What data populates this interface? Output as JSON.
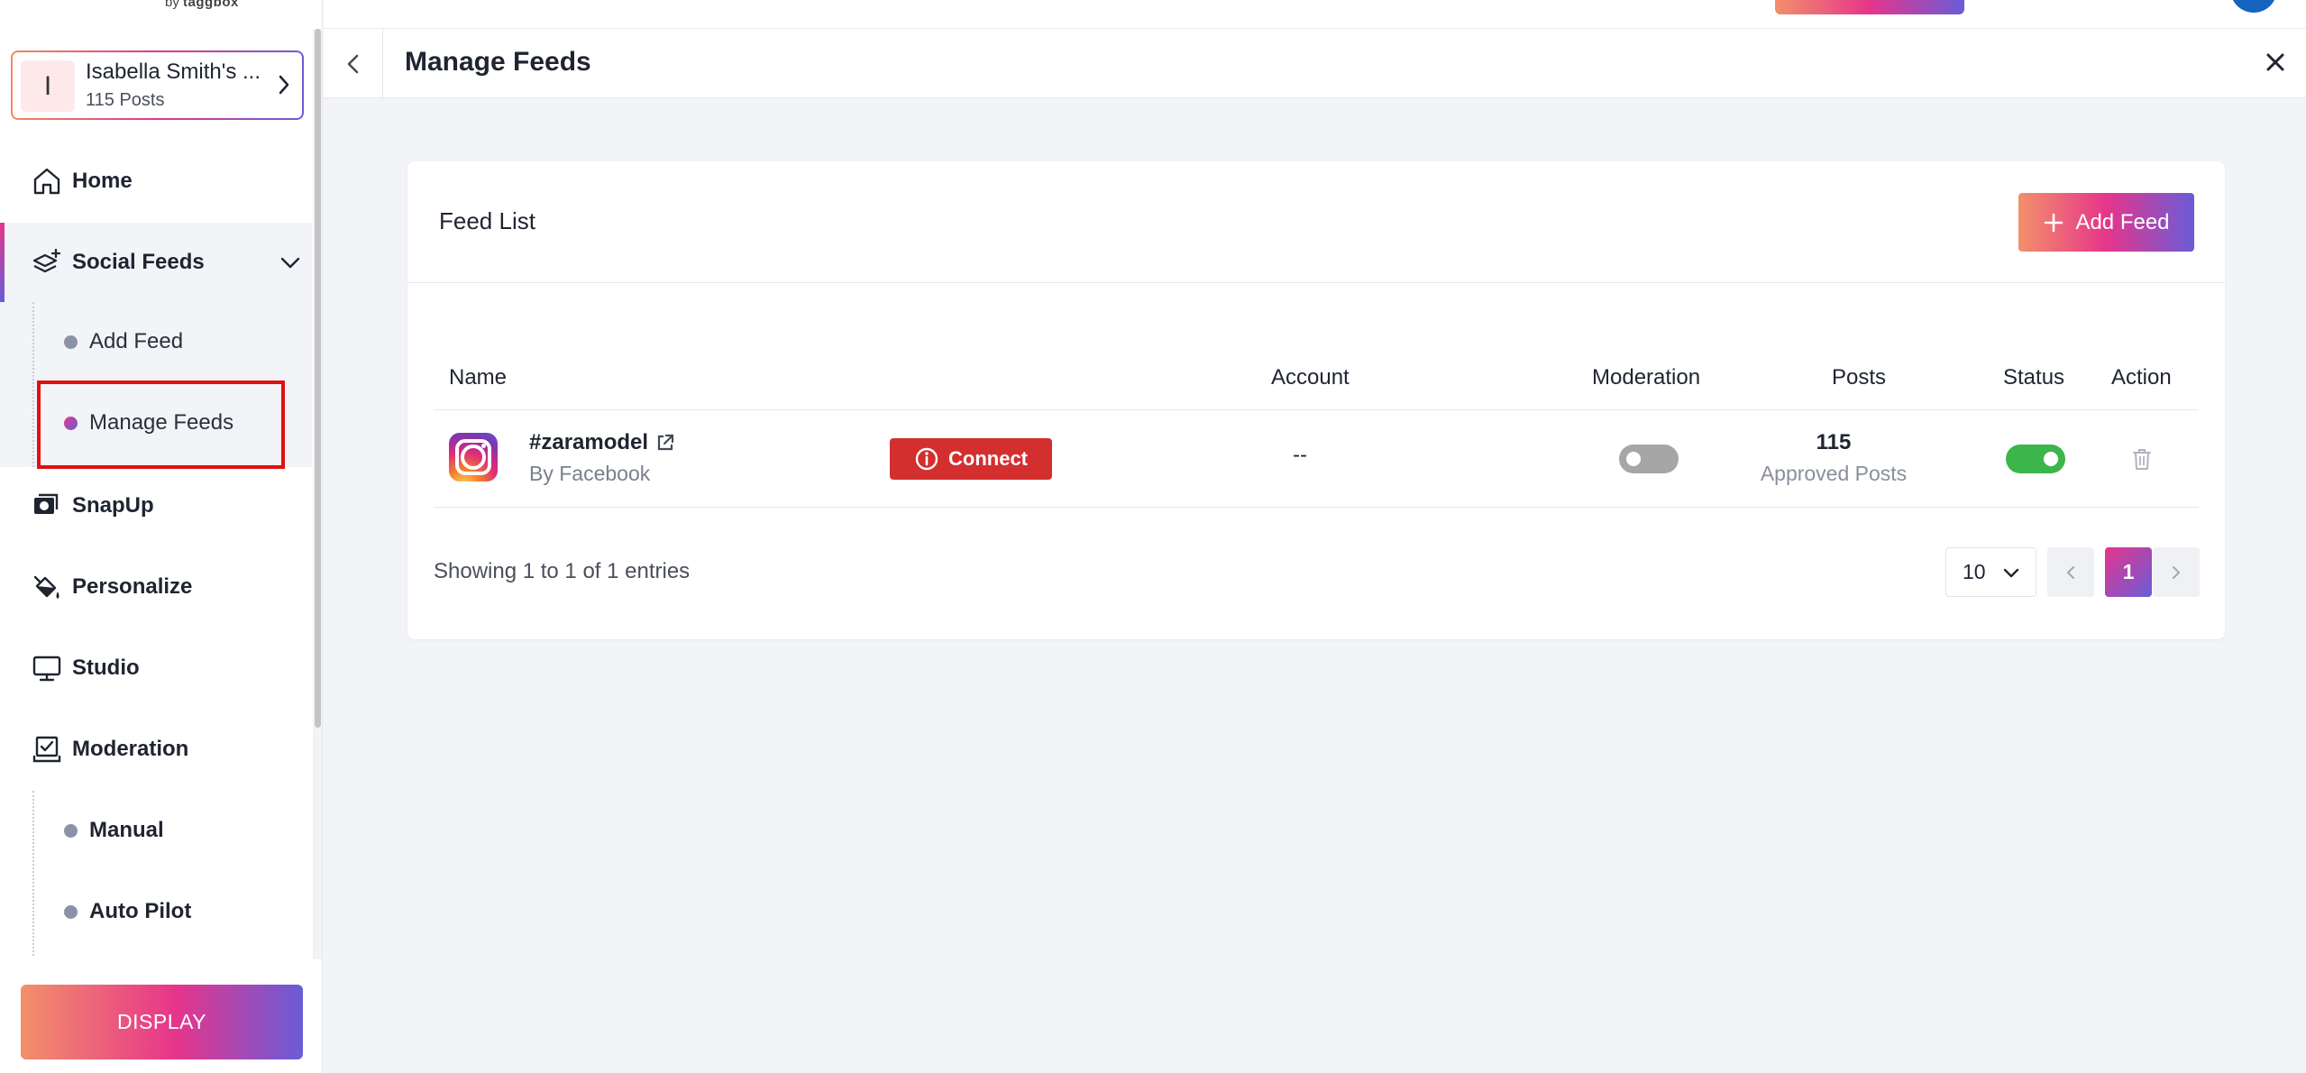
{
  "brand": {
    "prefix": "by",
    "name": "taggbox"
  },
  "account": {
    "initial": "I",
    "name": "Isabella Smith's ...",
    "posts": "115 Posts"
  },
  "nav": {
    "home": "Home",
    "social_feeds": "Social Feeds",
    "social_sub": {
      "add_feed": "Add Feed",
      "manage_feeds": "Manage Feeds"
    },
    "snapup": "SnapUp",
    "personalize": "Personalize",
    "studio": "Studio",
    "moderation": "Moderation",
    "moderation_sub": {
      "manual": "Manual",
      "auto_pilot": "Auto Pilot"
    }
  },
  "display_button": "DISPLAY",
  "page": {
    "title": "Manage Feeds"
  },
  "card": {
    "title": "Feed List",
    "add_feed_label": "Add Feed",
    "columns": {
      "name": "Name",
      "account": "Account",
      "moderation": "Moderation",
      "posts": "Posts",
      "status": "Status",
      "action": "Action"
    },
    "rows": [
      {
        "name": "#zaramodel",
        "source": "By Facebook",
        "network_icon": "instagram-icon",
        "connect_label": "Connect",
        "account": "--",
        "moderation_on": false,
        "posts_count": "115",
        "posts_label": "Approved Posts",
        "status_on": true
      }
    ],
    "entries_text": "Showing 1 to 1 of 1 entries",
    "page_size": "10",
    "current_page": "1"
  },
  "colors": {
    "accent_gradient": [
      "#f2906a",
      "#e6358b",
      "#6a5cd8"
    ],
    "connect_red": "#d32f2f",
    "toggle_on": "#3cb54a",
    "toggle_off": "#a6a6a6",
    "highlight_red": "#e01010"
  }
}
